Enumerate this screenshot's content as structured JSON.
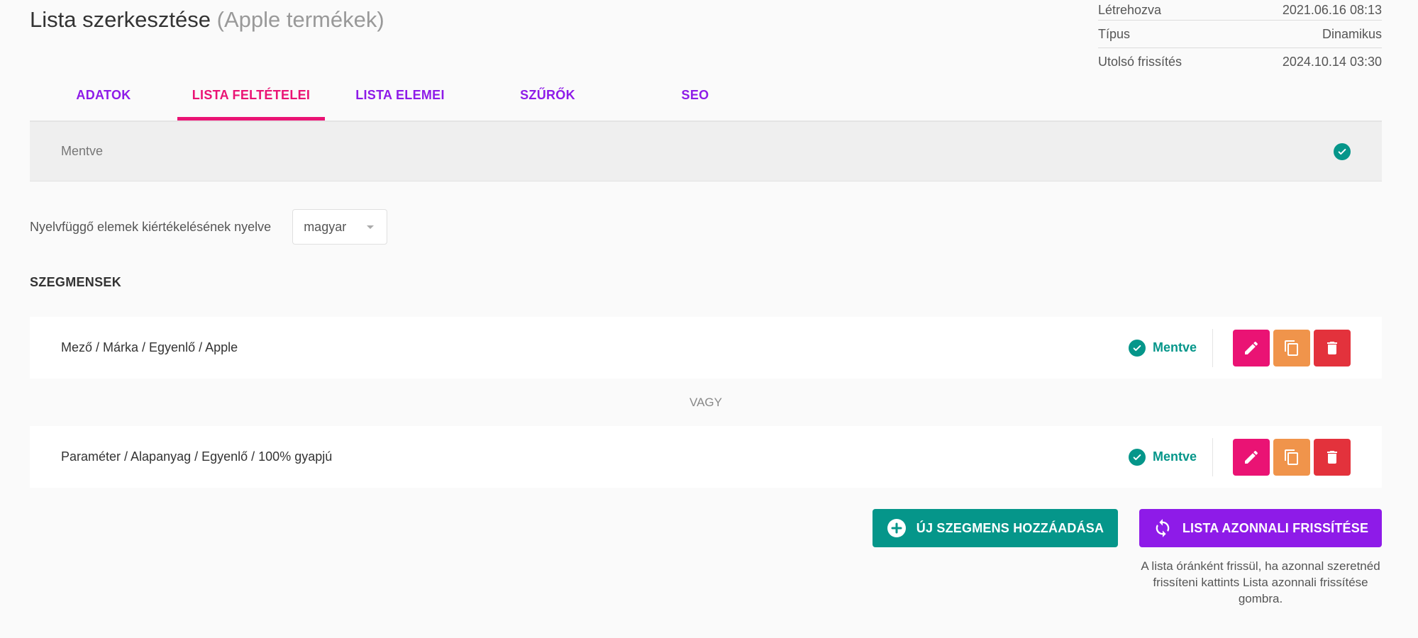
{
  "header": {
    "title": "Lista szerkesztése",
    "subtitle": "(Apple termékek)"
  },
  "meta": [
    {
      "label": "Létrehozva",
      "value": "2021.06.16 08:13"
    },
    {
      "label": "Típus",
      "value": "Dinamikus"
    },
    {
      "label": "Utolsó frissítés",
      "value": "2024.10.14 03:30"
    }
  ],
  "tabs": [
    {
      "label": "ADATOK",
      "active": false
    },
    {
      "label": "LISTA FELTÉTELEI",
      "active": true
    },
    {
      "label": "LISTA ELEMEI",
      "active": false
    },
    {
      "label": "SZŰRŐK",
      "active": false
    },
    {
      "label": "SEO",
      "active": false
    }
  ],
  "status_bar": {
    "label": "Mentve"
  },
  "language": {
    "label": "Nyelvfüggő elemek kiértékelésének nyelve",
    "selected": "magyar"
  },
  "segments": {
    "title": "SZEGMENSEK",
    "separator": "VAGY",
    "items": [
      {
        "text": "Mező / Márka / Egyenlő / Apple",
        "status": "Mentve"
      },
      {
        "text": "Paraméter / Alapanyag / Egyenlő / 100% gyapjú",
        "status": "Mentve"
      }
    ]
  },
  "buttons": {
    "add_segment": "ÚJ SZEGMENS HOZZÁADÁSA",
    "refresh": "LISTA AZONNALI FRISSÍTÉSE"
  },
  "hint": "A lista óránként frissül, ha azonnal szeretnéd frissíteni kattints Lista azonnali frissítése gombra.",
  "colors": {
    "accent_purple": "#8e1be8",
    "accent_pink": "#ea1374",
    "success_teal": "#05968a",
    "copy_orange": "#f0944b",
    "delete_red": "#e3323c"
  }
}
